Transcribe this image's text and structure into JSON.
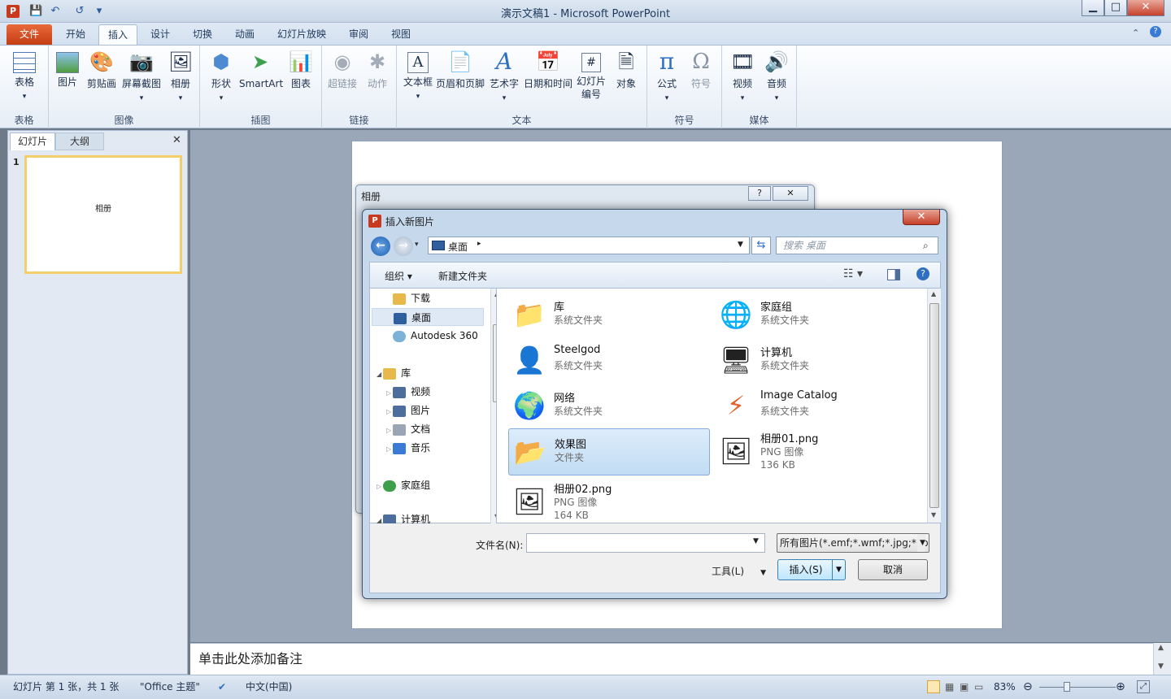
{
  "window": {
    "title": "演示文稿1 - Microsoft PowerPoint",
    "app_letter": "P"
  },
  "qat": {
    "save": "💾",
    "undo": "↶",
    "redo": "↺",
    "customize": "▾"
  },
  "window_controls": {
    "minimize": "▁",
    "maximize": "□",
    "close": "✕"
  },
  "tabs": [
    "文件",
    "开始",
    "插入",
    "设计",
    "切换",
    "动画",
    "幻灯片放映",
    "审阅",
    "视图"
  ],
  "ribbon": {
    "groups": {
      "tables": "表格",
      "images": "图像",
      "illustrations": "插图",
      "links": "链接",
      "text": "文本",
      "symbols": "符号",
      "media": "媒体"
    },
    "buttons": {
      "table": "表格",
      "picture": "图片",
      "clipart": "剪贴画",
      "screenshot": "屏幕截图",
      "album": "相册",
      "shapes": "形状",
      "smartart": "SmartArt",
      "chart": "图表",
      "hyperlink": "超链接",
      "action": "动作",
      "textbox": "文本框",
      "headerfooter": "页眉和页脚",
      "wordart": "艺术字",
      "datetime": "日期和时间",
      "slidenumber_1": "幻灯片",
      "slidenumber_2": "编号",
      "object": "对象",
      "equation": "公式",
      "symbol": "符号",
      "video": "视频",
      "audio": "音频"
    }
  },
  "slides_panel": {
    "tab_slides": "幻灯片",
    "tab_outline": "大纲",
    "close": "✕",
    "slide_number": "1",
    "slide_title": "相册"
  },
  "notes": {
    "placeholder": "单击此处添加备注"
  },
  "statusbar": {
    "slide_info": "幻灯片 第 1 张，共 1 张",
    "theme": "\"Office 主题\"",
    "language": "中文(中国)",
    "zoom": "83%"
  },
  "album_dialog": {
    "title": "相册",
    "help": "?",
    "close": "✕"
  },
  "insert_dialog": {
    "title": "插入新图片",
    "address": "桌面",
    "search_placeholder": "搜索 桌面",
    "organize": "组织 ▾",
    "new_folder": "新建文件夹",
    "nav": [
      {
        "label": "下载",
        "color": "#e6b94a"
      },
      {
        "label": "桌面",
        "color": "#2f5f9e"
      },
      {
        "label": "Autodesk 360",
        "color": "#7db2d8"
      },
      {
        "label": "库",
        "color": "#e6b94a"
      },
      {
        "label": "视频",
        "color": "#4d6e9c"
      },
      {
        "label": "图片",
        "color": "#4d6e9c"
      },
      {
        "label": "文档",
        "color": "#9aa6b6"
      },
      {
        "label": "音乐",
        "color": "#3a7bd5"
      },
      {
        "label": "家庭组",
        "color": "#3f9e4a"
      },
      {
        "label": "计算机",
        "color": "#4d6e9c"
      }
    ],
    "files": [
      {
        "name": "库",
        "type": "系统文件夹",
        "icon": "📁"
      },
      {
        "name": "家庭组",
        "type": "系统文件夹",
        "icon": "🌐"
      },
      {
        "name": "Steelgod",
        "type": "系统文件夹",
        "icon": "👤"
      },
      {
        "name": "计算机",
        "type": "系统文件夹",
        "icon": "🖥"
      },
      {
        "name": "网络",
        "type": "系统文件夹",
        "icon": "🌍"
      },
      {
        "name": "Image Catalog",
        "type": "系统文件夹",
        "icon": "⚡"
      },
      {
        "name": "效果图",
        "type": "文件夹",
        "icon": "📂"
      },
      {
        "name": "相册01.png",
        "type": "PNG 图像",
        "size": "136 KB",
        "icon": "🖼"
      },
      {
        "name": "相册02.png",
        "type": "PNG 图像",
        "size": "164 KB",
        "icon": "🖼"
      }
    ],
    "filename_label": "文件名(N):",
    "filename_value": "",
    "filter": "所有图片(*.emf;*.wmf;*.jpg;*.jp",
    "tools": "工具(L)",
    "insert_btn": "插入(S)",
    "cancel_btn": "取消"
  }
}
